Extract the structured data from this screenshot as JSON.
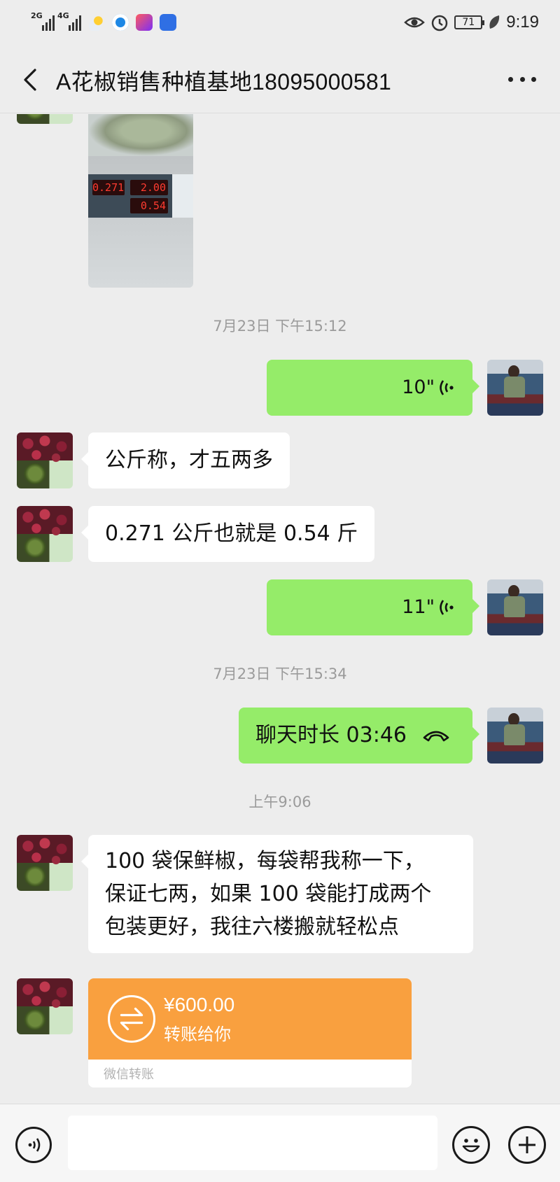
{
  "status_bar": {
    "net1": "2G",
    "net2": "4G",
    "battery": "71",
    "time": "9:19",
    "icons": [
      "signal-icon",
      "weather-icon",
      "browser-icon",
      "video-app-icon",
      "baidu-icon",
      "eye-icon",
      "alarm-icon",
      "leaf-icon"
    ]
  },
  "header": {
    "title": "A花椒销售种植基地18095000581",
    "back_icon": "chevron-left-icon",
    "more_icon": "more-dots-icon"
  },
  "messages": {
    "photo": {
      "lcd1": "0.271",
      "lcd2": "2.00",
      "lcd3": "0.54"
    },
    "ts1": "7月23日 下午15:12",
    "voice1": "10\"",
    "text1": "公斤称，才五两多",
    "text2": "0.271 公斤也就是 0.54 斤",
    "voice2": "11\"",
    "ts2": "7月23日 下午15:34",
    "call": "聊天时长 03:46",
    "ts3": "上午9:06",
    "text3_line1": "100 袋保鲜椒，每袋帮我称一下，",
    "text3_line2": "保证七两，如果 100 袋能打成两个",
    "text3_line3": "包装更好，我往六楼搬就轻松点",
    "transfer": {
      "amount": "¥600.00",
      "desc": "转账给你",
      "footer": "微信转账"
    }
  },
  "input_bar": {
    "placeholder": "",
    "icons": [
      "voice-input-icon",
      "emoji-icon",
      "plus-icon"
    ]
  },
  "colors": {
    "background": "#ededed",
    "outgoing_bubble": "#95ec69",
    "incoming_bubble": "#ffffff",
    "transfer": "#f9a03f",
    "timestamp": "#9b9b9b"
  }
}
